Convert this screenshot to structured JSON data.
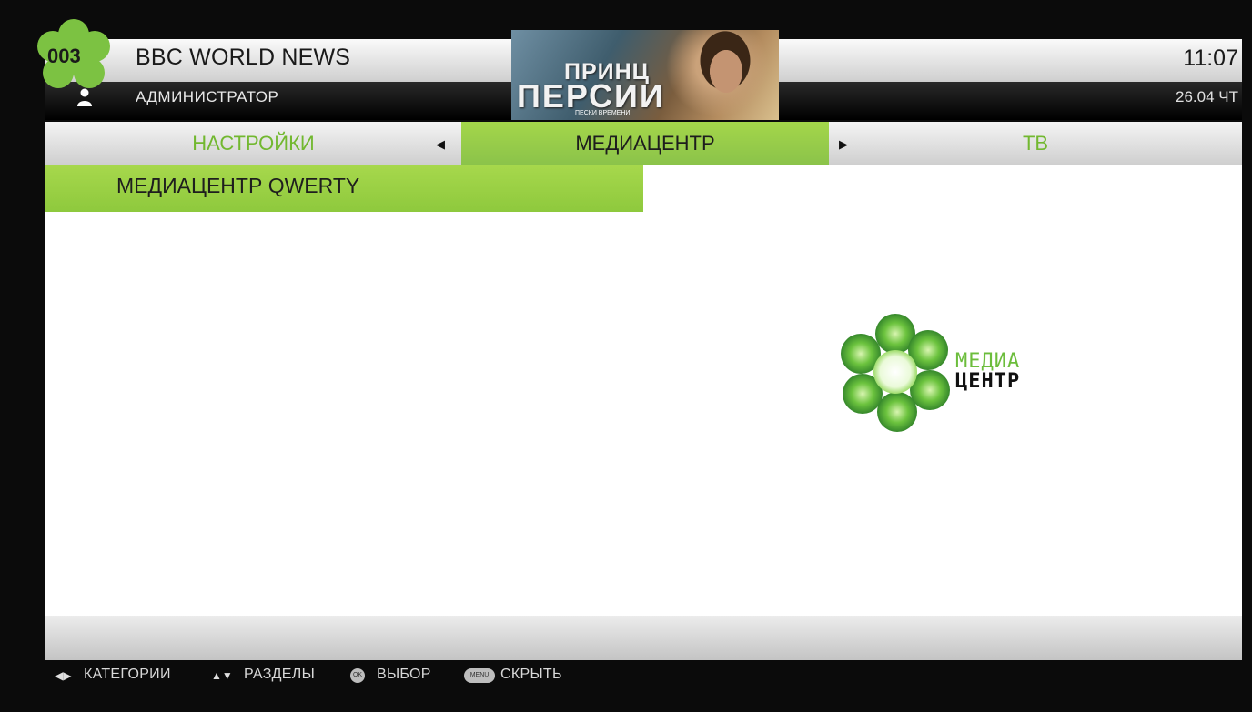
{
  "header": {
    "channel_number": "003",
    "channel_name": "BBC WORLD NEWS",
    "user": "АДМИНИСТРАТОР",
    "time": "11:07",
    "date": "26.04 ЧТ",
    "poster": {
      "title_line1": "ПРИНЦ",
      "title_line2": "ПЕРСИИ",
      "subtitle": "ПЕСКИ ВРЕМЕНИ"
    }
  },
  "tabs": {
    "left": "НАСТРОЙКИ",
    "center": "МЕДИАЦЕНТР",
    "right": "ТВ"
  },
  "content": {
    "subtab": "МЕДИАЦЕНТР QWERTY",
    "logo_line1": "МЕДИА",
    "logo_line2": "ЦЕНТР"
  },
  "footer": {
    "categories": "КАТЕГОРИИ",
    "sections": "РАЗДЕЛЫ",
    "ok_button": "OK",
    "select": "ВЫБОР",
    "menu_button": "MENU",
    "hide": "СКРЫТЬ"
  },
  "colors": {
    "accent_green": "#8ec93d",
    "tab_text_green": "#72b830"
  },
  "icons": [
    "clover-logo-icon",
    "user-icon",
    "arrow-left-icon",
    "arrow-right-icon",
    "left-right-arrows-icon",
    "up-down-arrows-icon",
    "ok-button-icon",
    "menu-button-icon"
  ]
}
